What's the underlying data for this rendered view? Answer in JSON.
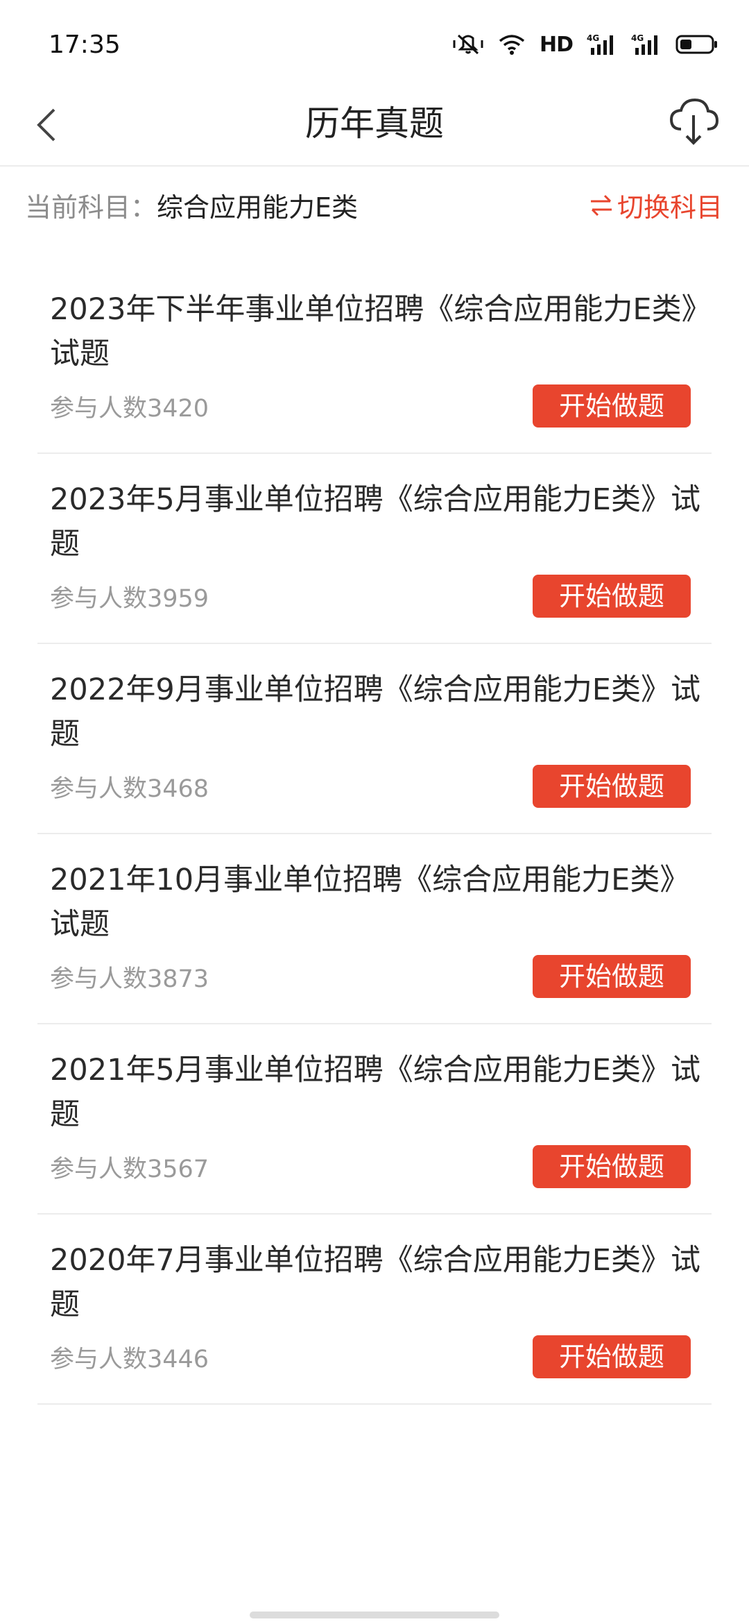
{
  "status_bar": {
    "time": "17:35",
    "hd_label": "HD",
    "network_1": "4G",
    "network_2": "4G"
  },
  "nav": {
    "title": "历年真题",
    "back_icon": "chevron-left-icon",
    "download_icon": "cloud-download-icon"
  },
  "subject": {
    "label": "当前科目：",
    "value": "综合应用能力E类",
    "switch_label": "切换科目",
    "switch_icon": "swap-arrows-icon"
  },
  "colors": {
    "accent": "#e8452e",
    "divider": "#ececec",
    "muted_text": "#9a9a9a"
  },
  "exams": [
    {
      "title": "2023年下半年事业单位招聘《综合应用能力E类》试题",
      "participants": "参与人数3420",
      "button": "开始做题"
    },
    {
      "title": "2023年5月事业单位招聘《综合应用能力E类》试题",
      "participants": "参与人数3959",
      "button": "开始做题"
    },
    {
      "title": "2022年9月事业单位招聘《综合应用能力E类》试题",
      "participants": "参与人数3468",
      "button": "开始做题"
    },
    {
      "title": "2021年10月事业单位招聘《综合应用能力E类》试题",
      "participants": "参与人数3873",
      "button": "开始做题"
    },
    {
      "title": "2021年5月事业单位招聘《综合应用能力E类》试题",
      "participants": "参与人数3567",
      "button": "开始做题"
    },
    {
      "title": "2020年7月事业单位招聘《综合应用能力E类》试题",
      "participants": "参与人数3446",
      "button": "开始做题"
    }
  ]
}
